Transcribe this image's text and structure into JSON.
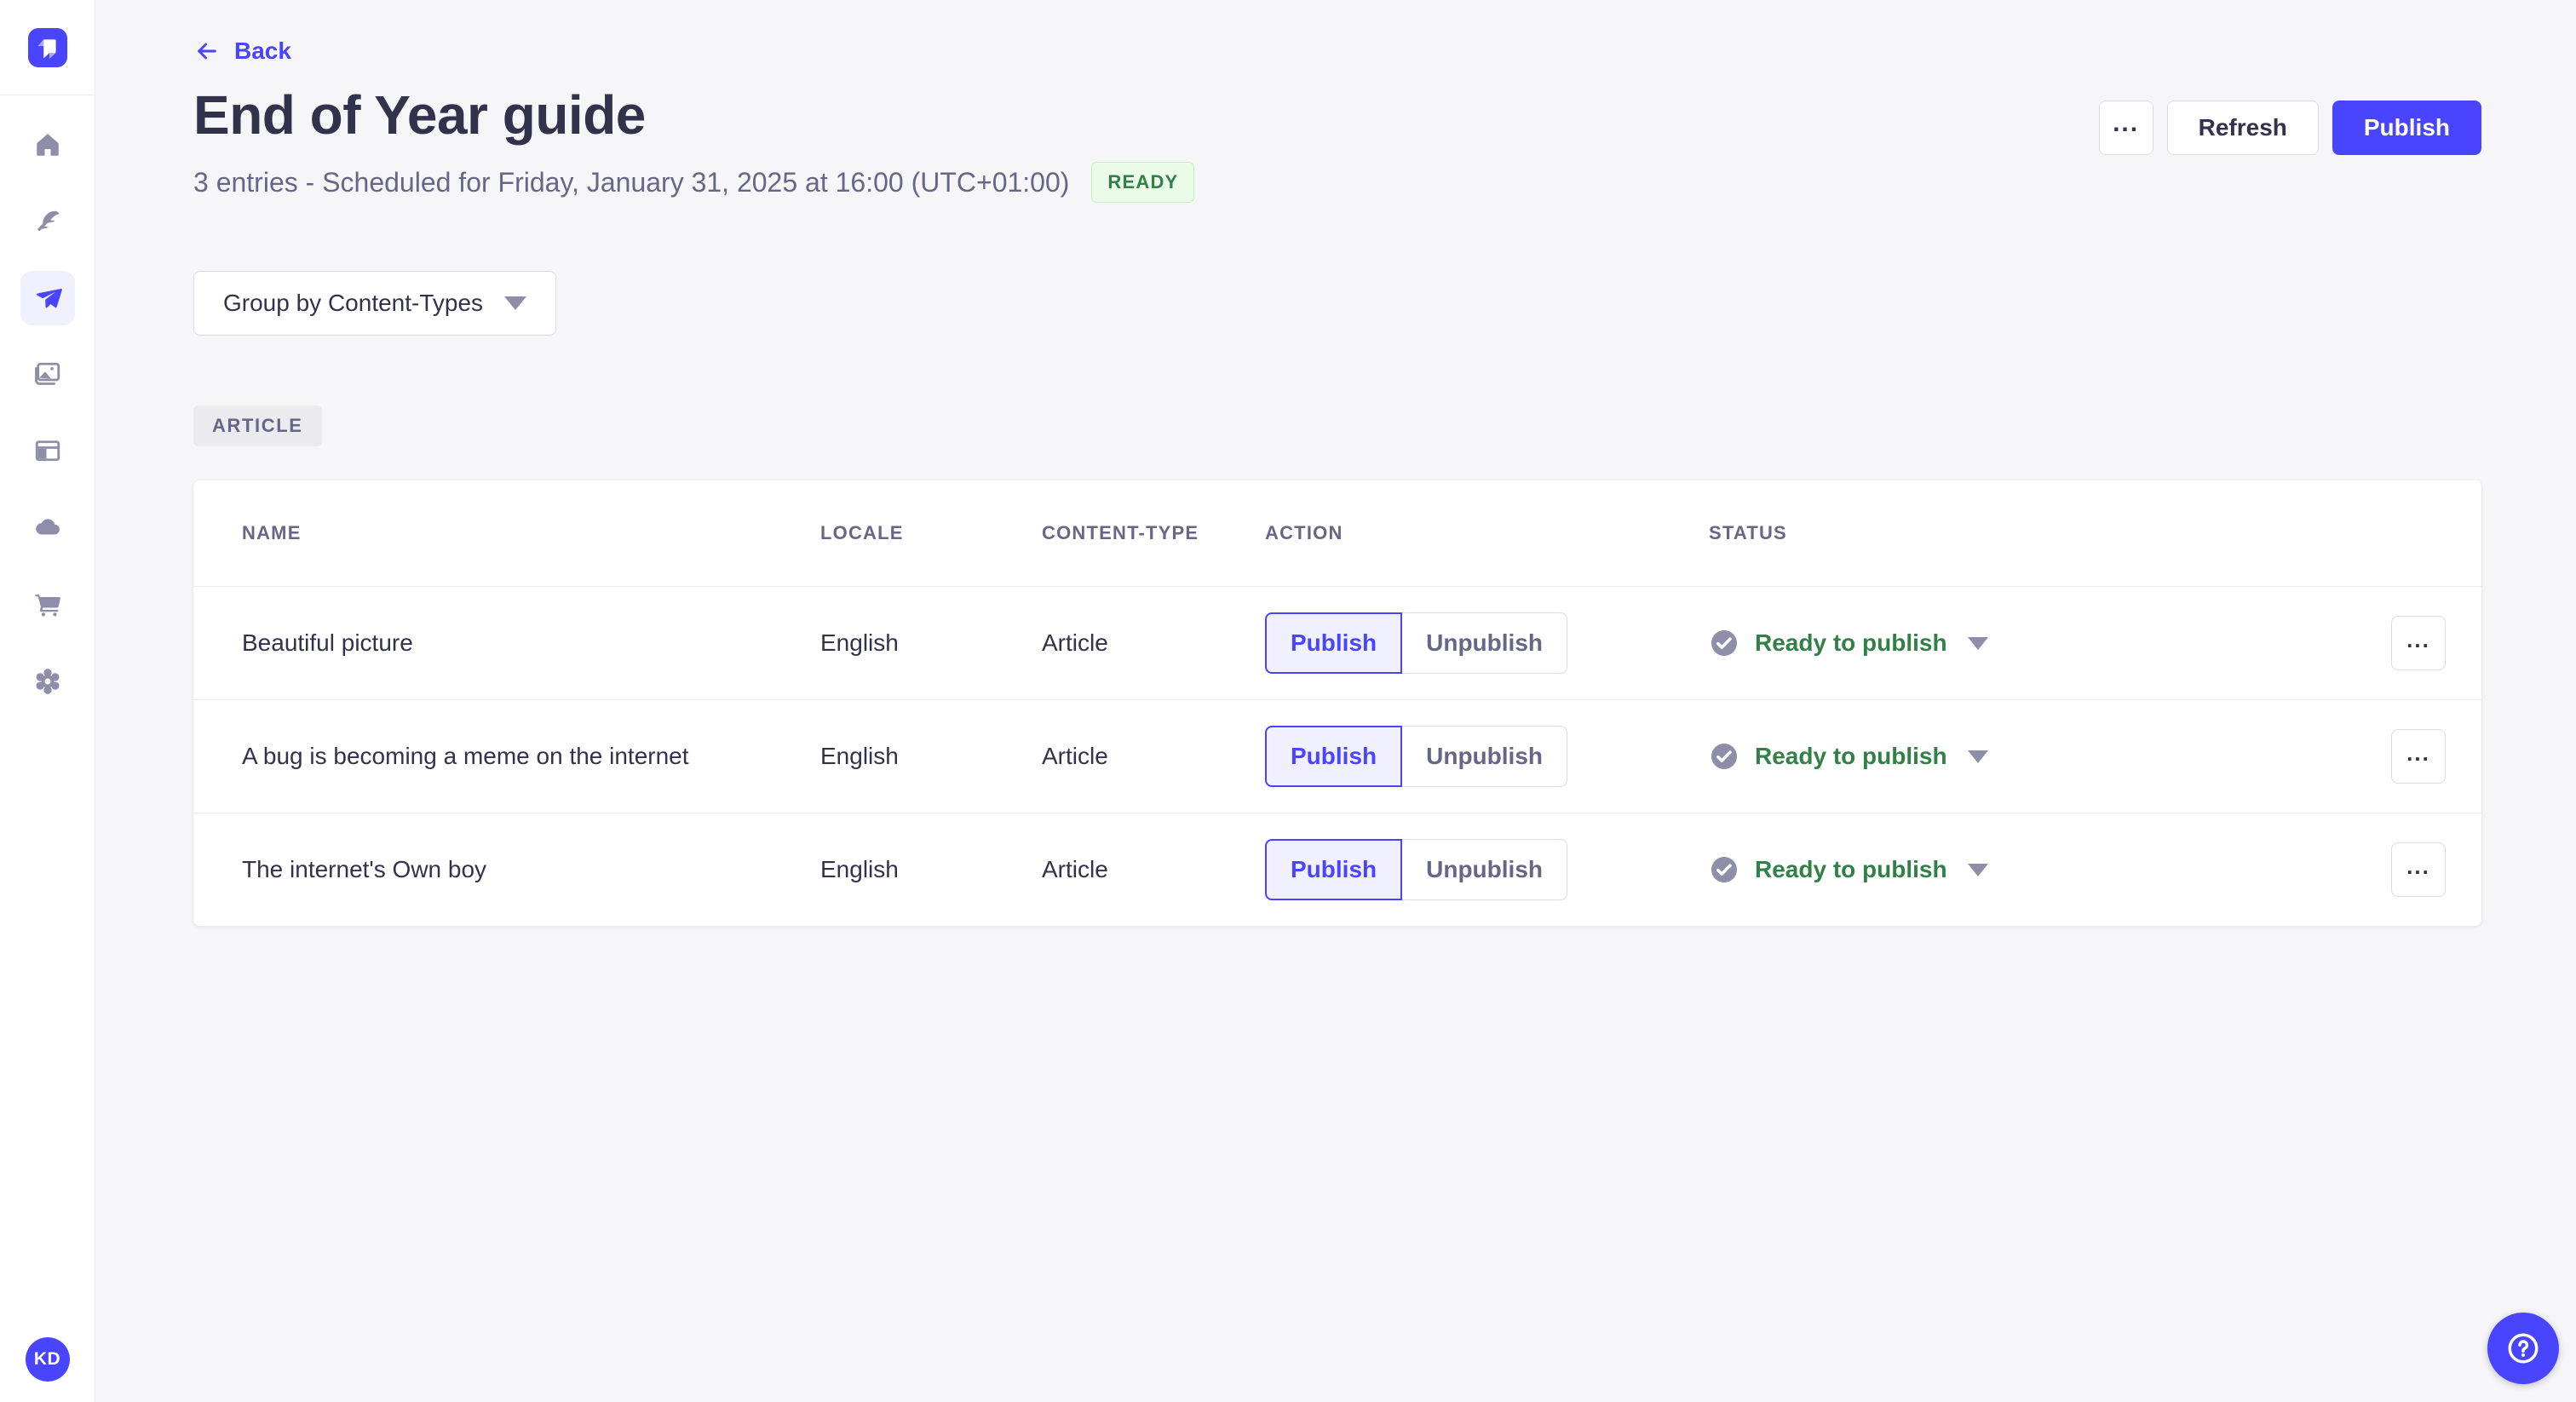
{
  "colors": {
    "primary": "#4945ff",
    "primary_light": "#f0f0ff",
    "background": "#f6f6f9",
    "surface": "#ffffff",
    "border": "#dcdce4",
    "divider": "#eaeaef",
    "text": "#32324d",
    "text_muted": "#666687",
    "icon_gray": "#8e8ea9",
    "success_text": "#328048",
    "success_bg": "#eafbe7",
    "success_border": "#c6f0c2"
  },
  "sidebar": {
    "logo_icon": "strapi-logo",
    "items": [
      {
        "icon": "home-icon",
        "active": false
      },
      {
        "icon": "feather-icon",
        "active": false
      },
      {
        "icon": "paper-plane-icon",
        "active": true
      },
      {
        "icon": "media-library-icon",
        "active": false
      },
      {
        "icon": "layout-icon",
        "active": false
      },
      {
        "icon": "cloud-icon",
        "active": false
      },
      {
        "icon": "cart-icon",
        "active": false
      },
      {
        "icon": "gear-icon",
        "active": false
      }
    ],
    "avatar_initials": "KD"
  },
  "header": {
    "back_label": "Back",
    "title": "End of Year guide",
    "subtitle": "3 entries - Scheduled for Friday, January 31, 2025 at 16:00 (UTC+01:00)",
    "status_badge": "READY",
    "more_label": "...",
    "refresh_label": "Refresh",
    "publish_label": "Publish"
  },
  "toolbar": {
    "group_by_label": "Group by Content-Types"
  },
  "group": {
    "badge": "ARTICLE"
  },
  "table": {
    "columns": [
      "NAME",
      "LOCALE",
      "CONTENT-TYPE",
      "ACTION",
      "STATUS"
    ],
    "row_more_label": "...",
    "rows": [
      {
        "name": "Beautiful picture",
        "locale": "English",
        "content_type": "Article",
        "publish_label": "Publish",
        "unpublish_label": "Unpublish",
        "selected_action": "Publish",
        "status": "Ready to publish"
      },
      {
        "name": "A bug is becoming a meme on the internet",
        "locale": "English",
        "content_type": "Article",
        "publish_label": "Publish",
        "unpublish_label": "Unpublish",
        "selected_action": "Publish",
        "status": "Ready to publish"
      },
      {
        "name": "The internet's Own boy",
        "locale": "English",
        "content_type": "Article",
        "publish_label": "Publish",
        "unpublish_label": "Unpublish",
        "selected_action": "Publish",
        "status": "Ready to publish"
      }
    ]
  }
}
